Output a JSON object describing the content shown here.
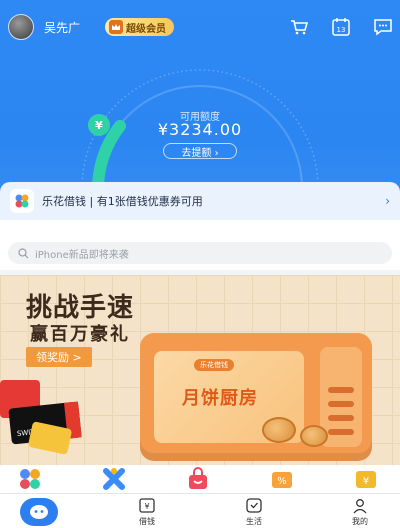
{
  "header": {
    "username": "吴先广",
    "vip_label": "超级会员",
    "message_count": "13"
  },
  "credit": {
    "label": "可用额度",
    "amount": "¥3234.00",
    "withdraw_label": "去提额 ›"
  },
  "notice": {
    "text": "乐花借钱 | 有1张借钱优惠券可用",
    "chevron": "›"
  },
  "search": {
    "placeholder": "iPhone新品即将来袭"
  },
  "banner": {
    "headline": "挑战手速",
    "subline": "赢百万豪礼",
    "cta": "领奖励 >",
    "tag": "乐花借钱",
    "microwave_title": "月饼厨房",
    "switch_text": "SWITCH"
  },
  "nav": {
    "items": [
      {
        "label": "借钱"
      },
      {
        "label": "生活"
      },
      {
        "label": "我的"
      }
    ]
  },
  "colors": {
    "primary": "#2d86f2",
    "accent_green": "#2fd2a6",
    "banner_orange": "#f39a4e"
  }
}
